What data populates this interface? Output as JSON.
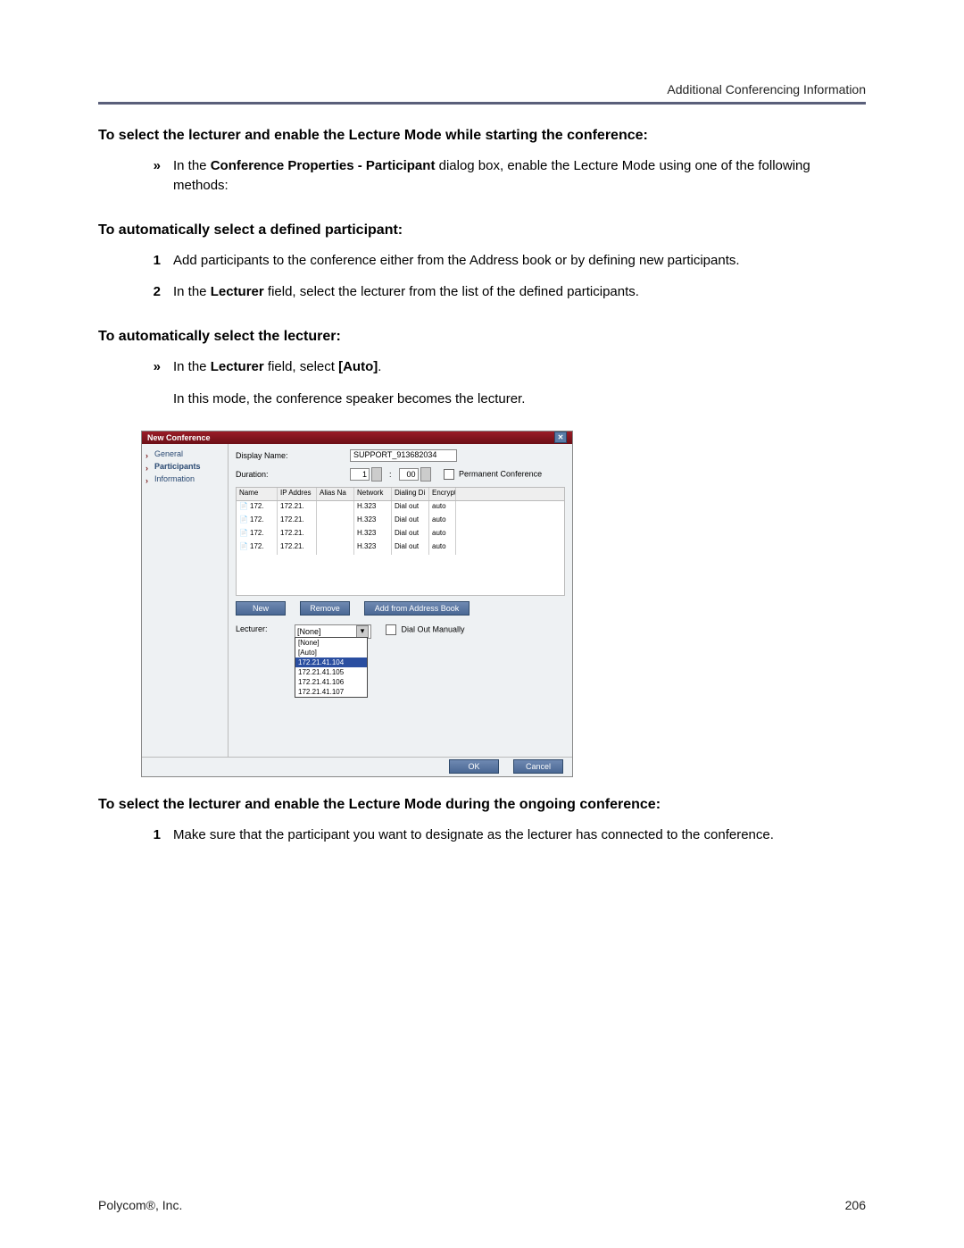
{
  "header": {
    "right": "Additional Conferencing Information"
  },
  "sections": [
    {
      "title": "To select the lecturer and enable the Lecture Mode while starting the conference:",
      "items": [
        {
          "marker": "»",
          "html": "In the <b>Conference Properties - Participant</b> dialog box, enable the Lecture Mode using one of the following methods:"
        }
      ]
    },
    {
      "title": "To automatically select a defined participant:",
      "items": [
        {
          "marker": "1",
          "html": "Add participants to the conference either from the Address book or by defining new participants."
        },
        {
          "marker": "2",
          "html": "In the <b>Lecturer</b> field, select the lecturer from the list of the defined participants."
        }
      ]
    },
    {
      "title": "To automatically select the lecturer:",
      "items": [
        {
          "marker": "»",
          "html": "In the <b>Lecturer</b> field, select <b>[Auto]</b>."
        },
        {
          "marker": "",
          "html": "In this mode, the conference speaker becomes the lecturer."
        }
      ]
    }
  ],
  "dialog": {
    "title": "New Conference",
    "nav": {
      "items": [
        "General",
        "Participants",
        "Information"
      ],
      "active": 1
    },
    "display_name_label": "Display Name:",
    "display_name_value": "SUPPORT_913682034",
    "duration_label": "Duration:",
    "duration_h": "1",
    "duration_sep": ":",
    "duration_m": "00",
    "permanent_label": "Permanent Conference",
    "table": {
      "headers": [
        "Name",
        "IP Addres",
        "Alias Na",
        "Network",
        "Dialing Di",
        "Encryption"
      ],
      "rows": [
        [
          "172.",
          "172.21.",
          "",
          "H.323",
          "Dial out",
          "auto"
        ],
        [
          "172.",
          "172.21.",
          "",
          "H.323",
          "Dial out",
          "auto"
        ],
        [
          "172.",
          "172.21.",
          "",
          "H.323",
          "Dial out",
          "auto"
        ],
        [
          "172.",
          "172.21.",
          "",
          "H.323",
          "Dial out",
          "auto"
        ]
      ]
    },
    "buttons": {
      "new": "New",
      "remove": "Remove",
      "add_ab": "Add from Address Book"
    },
    "lecturer_label": "Lecturer:",
    "lecturer_value": "[None]",
    "lecturer_options": [
      "[None]",
      "[Auto]",
      "172.21.41.104",
      "172.21.41.105",
      "172.21.41.106",
      "172.21.41.107"
    ],
    "lecturer_highlight": 2,
    "dial_out_checkbox": "Dial Out Manually",
    "ok": "OK",
    "cancel": "Cancel"
  },
  "post": {
    "title": "To select the lecturer and enable the Lecture Mode during the ongoing conference:",
    "items": [
      {
        "marker": "1",
        "html": "Make sure that the participant you want to designate as the lecturer has connected to the conference."
      }
    ]
  },
  "footer": {
    "left": "Polycom®, Inc.",
    "right": "206"
  }
}
